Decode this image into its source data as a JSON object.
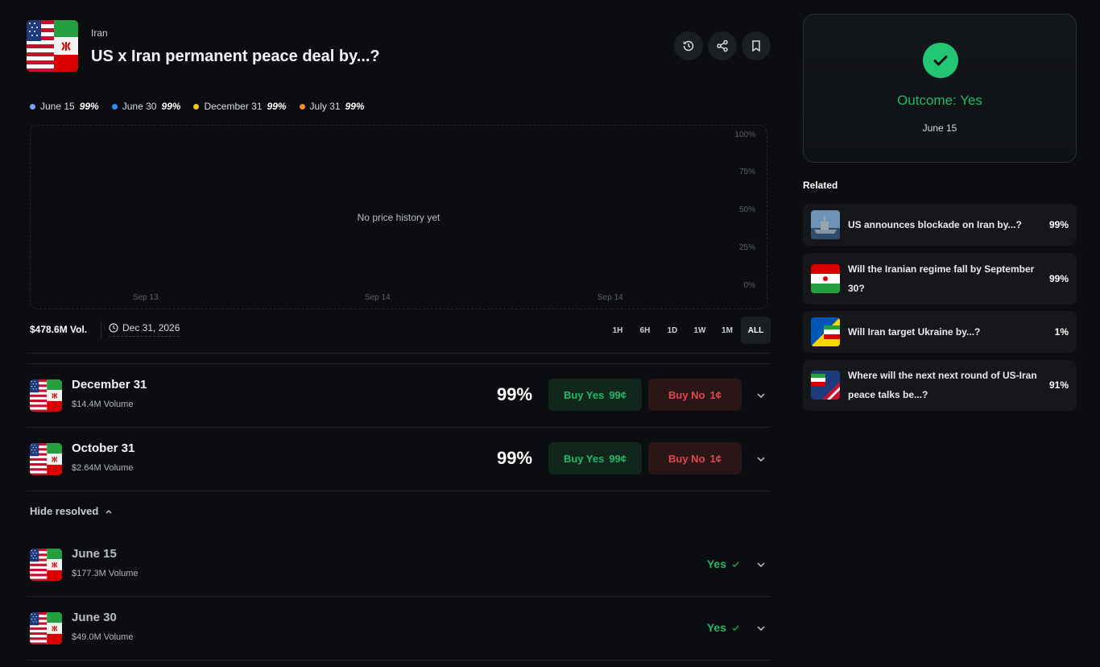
{
  "header": {
    "category": "Iran",
    "title": "US x Iran permanent peace deal by...?"
  },
  "legend": [
    {
      "label": "June 15",
      "pct": "99%",
      "color": "#6ea8ff"
    },
    {
      "label": "June 30",
      "pct": "99%",
      "color": "#2f8cff"
    },
    {
      "label": "December 31",
      "pct": "99%",
      "color": "#f5c518"
    },
    {
      "label": "July 31",
      "pct": "99%",
      "color": "#ff8a2a"
    }
  ],
  "chart": {
    "empty_text": "No price history yet",
    "y_ticks": [
      "100%",
      "75%",
      "50%",
      "25%",
      "0%"
    ],
    "x_ticks": [
      "Sep 13",
      "Sep 14",
      "Sep 14"
    ]
  },
  "info": {
    "volume": "$478.6M Vol.",
    "end_date": "Dec 31, 2026"
  },
  "ranges": [
    "1H",
    "6H",
    "1D",
    "1W",
    "1M",
    "ALL"
  ],
  "markets": [
    {
      "title": "December 31",
      "volume": "$14.4M Volume",
      "pct": "99%",
      "yes_label": "Buy Yes",
      "yes_price": "99¢",
      "no_label": "Buy No",
      "no_price": "1¢"
    },
    {
      "title": "October 31",
      "volume": "$2.64M Volume",
      "pct": "99%",
      "yes_label": "Buy Yes",
      "yes_price": "99¢",
      "no_label": "Buy No",
      "no_price": "1¢"
    }
  ],
  "hide_resolved": "Hide resolved",
  "resolved": [
    {
      "title": "June 15",
      "volume": "$177.3M Volume",
      "result": "Yes"
    },
    {
      "title": "June 30",
      "volume": "$49.0M Volume",
      "result": "Yes"
    }
  ],
  "outcome": {
    "text": "Outcome: Yes",
    "date": "June 15"
  },
  "related_heading": "Related",
  "related": [
    {
      "title": "US announces blockade on Iran by...?",
      "pct": "99%"
    },
    {
      "title": "Will the Iranian regime fall by September 30?",
      "pct": "99%"
    },
    {
      "title": "Will Iran target Ukraine by...?",
      "pct": "1%"
    },
    {
      "title": "Where will the next next round of US-Iran peace talks be...?",
      "pct": "91%"
    }
  ],
  "colors": {
    "accent_green": "#22b868",
    "accent_red": "#e0484d",
    "background": "#0b0d10"
  }
}
